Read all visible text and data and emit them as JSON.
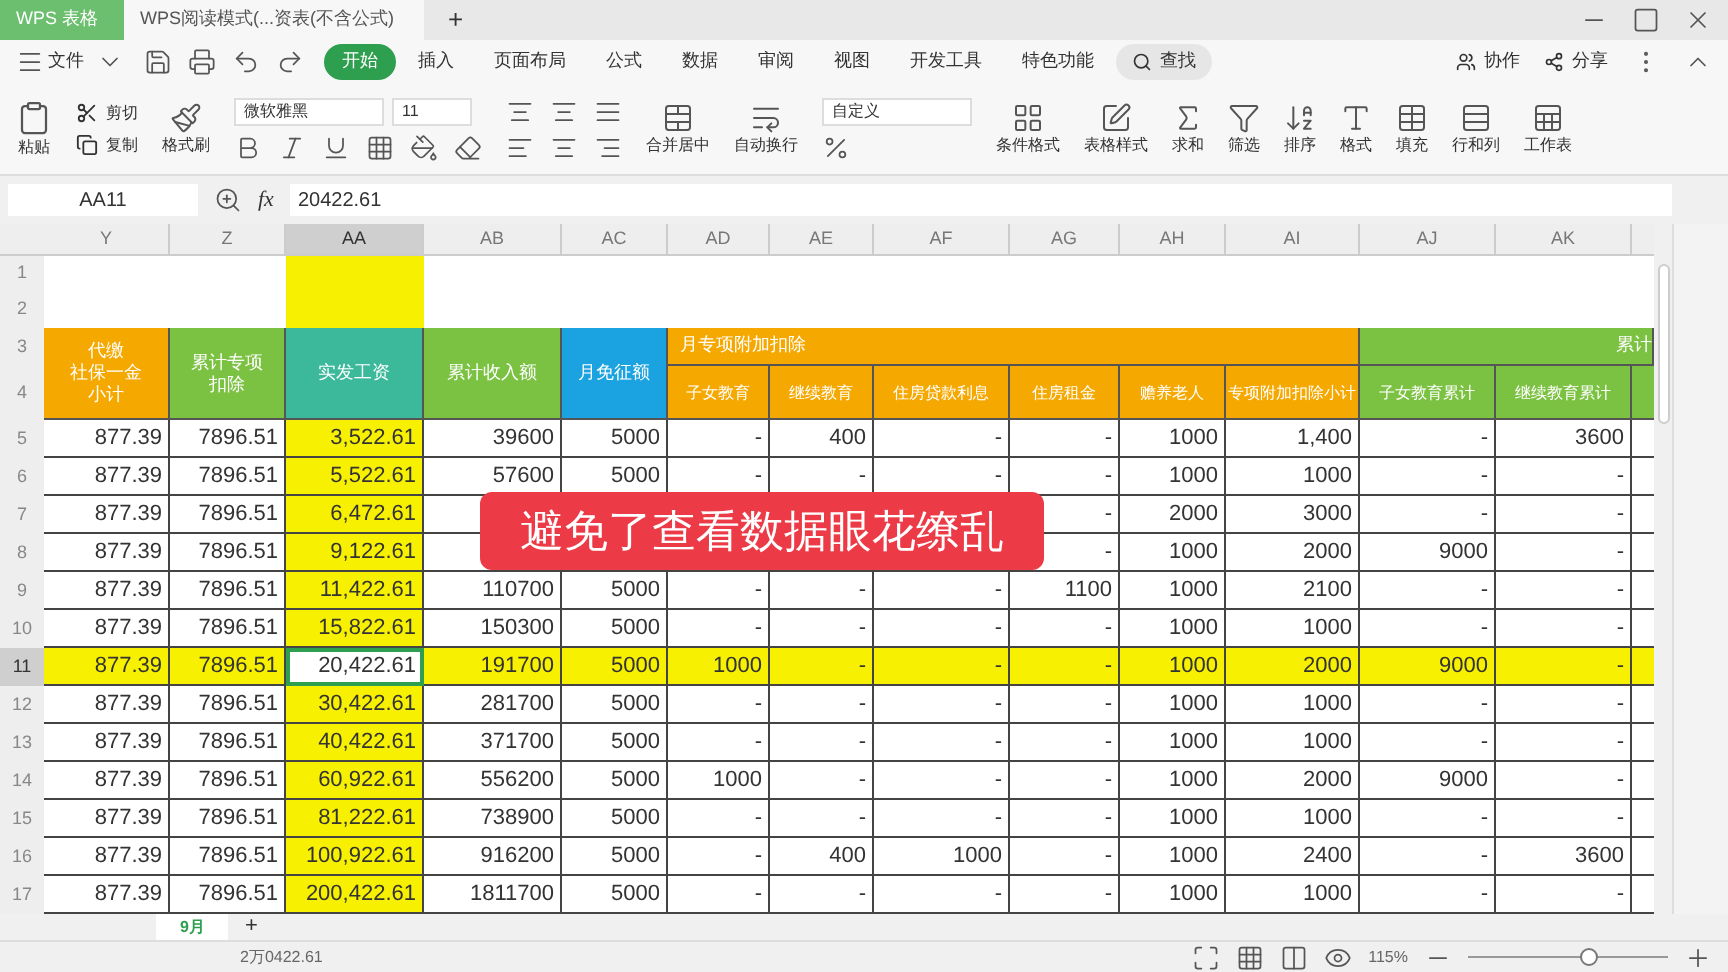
{
  "title_bar": {
    "tabs": [
      {
        "label": "WPS 表格",
        "selected": false
      },
      {
        "label": "WPS阅读模式(...资表(不含公式)",
        "selected": true
      }
    ],
    "new_tab": "+"
  },
  "menu": {
    "file": "文件",
    "items": [
      {
        "label": "开始",
        "selected": true
      },
      {
        "label": "插入",
        "selected": false
      },
      {
        "label": "页面布局",
        "selected": false
      },
      {
        "label": "公式",
        "selected": false
      },
      {
        "label": "数据",
        "selected": false
      },
      {
        "label": "审阅",
        "selected": false
      },
      {
        "label": "视图",
        "selected": false
      },
      {
        "label": "开发工具",
        "selected": false
      },
      {
        "label": "特色功能",
        "selected": false
      }
    ],
    "search": "查找",
    "collab": "协作",
    "share": "分享"
  },
  "ribbon": {
    "paste": "粘贴",
    "cut": "剪切",
    "copy": "复制",
    "painter": "格式刷",
    "font": "微软雅黑",
    "size": "11",
    "merge": "合并居中",
    "wrap": "自动换行",
    "number_format": "自定义",
    "tools": [
      "条件格式",
      "表格样式",
      "求和",
      "筛选",
      "排序",
      "格式",
      "填充",
      "行和列",
      "工作表"
    ]
  },
  "formula_bar": {
    "name_box": "AA11",
    "fx": "fx",
    "value": "20422.61"
  },
  "columns": [
    {
      "label": "Y",
      "selected": false
    },
    {
      "label": "Z",
      "selected": false
    },
    {
      "label": "AA",
      "selected": true
    },
    {
      "label": "AB",
      "selected": false
    },
    {
      "label": "AC",
      "selected": false
    },
    {
      "label": "AD",
      "selected": false
    },
    {
      "label": "AE",
      "selected": false
    },
    {
      "label": "AF",
      "selected": false
    },
    {
      "label": "AG",
      "selected": false
    },
    {
      "label": "AH",
      "selected": false
    },
    {
      "label": "AI",
      "selected": false
    },
    {
      "label": "AJ",
      "selected": false
    },
    {
      "label": "AK",
      "selected": false
    }
  ],
  "header_row_numbers": [
    "1",
    "2",
    "3",
    "4"
  ],
  "field_headers": [
    {
      "lines": [
        "代缴",
        "社保一金",
        "小计"
      ],
      "color": "#f5a800"
    },
    {
      "lines": [
        "累计专项",
        "扣除"
      ],
      "color": "#7cc242"
    },
    {
      "lines": [
        "实发工资"
      ],
      "color": "#3cb89a"
    },
    {
      "lines": [
        "累计收入额"
      ],
      "color": "#7cc242"
    },
    {
      "lines": [
        "月免征额"
      ],
      "color": "#1aa3e0"
    }
  ],
  "groups": [
    {
      "title": "月专项附加扣除",
      "color": "#f5a800",
      "columns": [
        "子女教育",
        "继续教育",
        "住房贷款利息",
        "住房租金",
        "赡养老人",
        "专项附加扣除小计"
      ]
    },
    {
      "title": "累计",
      "color": "#7cc242",
      "columns": [
        "子女教育累计",
        "继续教育累计"
      ]
    }
  ],
  "rows": [
    {
      "number": "5",
      "selected": false,
      "cells": [
        "877.39",
        "7896.51",
        "3,522.61",
        "39600",
        "5000",
        "-",
        "400",
        "-",
        "-",
        "1000",
        "1,400",
        "-",
        "3600"
      ]
    },
    {
      "number": "6",
      "selected": false,
      "cells": [
        "877.39",
        "7896.51",
        "5,522.61",
        "57600",
        "5000",
        "-",
        "-",
        "-",
        "-",
        "1000",
        "1000",
        "-",
        "-"
      ]
    },
    {
      "number": "7",
      "selected": false,
      "cells": [
        "877.39",
        "7896.51",
        "6,472.61",
        null,
        null,
        null,
        null,
        null,
        "-",
        "2000",
        "3000",
        "-",
        "-"
      ]
    },
    {
      "number": "8",
      "selected": false,
      "cells": [
        "877.39",
        "7896.51",
        "9,122.61",
        null,
        null,
        null,
        null,
        null,
        "-",
        "1000",
        "2000",
        "9000",
        "-"
      ]
    },
    {
      "number": "9",
      "selected": false,
      "cells": [
        "877.39",
        "7896.51",
        "11,422.61",
        "110700",
        "5000",
        "-",
        "-",
        "-",
        "1100",
        "1000",
        "2100",
        "-",
        "-"
      ]
    },
    {
      "number": "10",
      "selected": false,
      "cells": [
        "877.39",
        "7896.51",
        "15,822.61",
        "150300",
        "5000",
        "-",
        "-",
        "-",
        "-",
        "1000",
        "1000",
        "-",
        "-"
      ]
    },
    {
      "number": "11",
      "selected": true,
      "cells": [
        "877.39",
        "7896.51",
        "20,422.61",
        "191700",
        "5000",
        "1000",
        "-",
        "-",
        "-",
        "1000",
        "2000",
        "9000",
        "-"
      ]
    },
    {
      "number": "12",
      "selected": false,
      "cells": [
        "877.39",
        "7896.51",
        "30,422.61",
        "281700",
        "5000",
        "-",
        "-",
        "-",
        "-",
        "1000",
        "1000",
        "-",
        "-"
      ]
    },
    {
      "number": "13",
      "selected": false,
      "cells": [
        "877.39",
        "7896.51",
        "40,422.61",
        "371700",
        "5000",
        "-",
        "-",
        "-",
        "-",
        "1000",
        "1000",
        "-",
        "-"
      ]
    },
    {
      "number": "14",
      "selected": false,
      "cells": [
        "877.39",
        "7896.51",
        "60,922.61",
        "556200",
        "5000",
        "1000",
        "-",
        "-",
        "-",
        "1000",
        "2000",
        "9000",
        "-"
      ]
    },
    {
      "number": "15",
      "selected": false,
      "cells": [
        "877.39",
        "7896.51",
        "81,222.61",
        "738900",
        "5000",
        "-",
        "-",
        "-",
        "-",
        "1000",
        "1000",
        "-",
        "-"
      ]
    },
    {
      "number": "16",
      "selected": false,
      "cells": [
        "877.39",
        "7896.51",
        "100,922.61",
        "916200",
        "5000",
        "-",
        "400",
        "1000",
        "-",
        "1000",
        "2400",
        "-",
        "3600"
      ]
    },
    {
      "number": "17",
      "selected": false,
      "cells": [
        "877.39",
        "7896.51",
        "200,422.61",
        "1811700",
        "5000",
        "-",
        "-",
        "-",
        "-",
        "1000",
        "1000",
        "-",
        "-"
      ]
    }
  ],
  "caption": "避免了查看数据眼花缭乱",
  "sheet_tabs": [
    {
      "label": "9月",
      "selected": true
    }
  ],
  "add_sheet": "+",
  "status_bar": {
    "value": "2万0422.61",
    "zoom": "115%",
    "zoom_level": {
      "level": 0.6
    }
  }
}
